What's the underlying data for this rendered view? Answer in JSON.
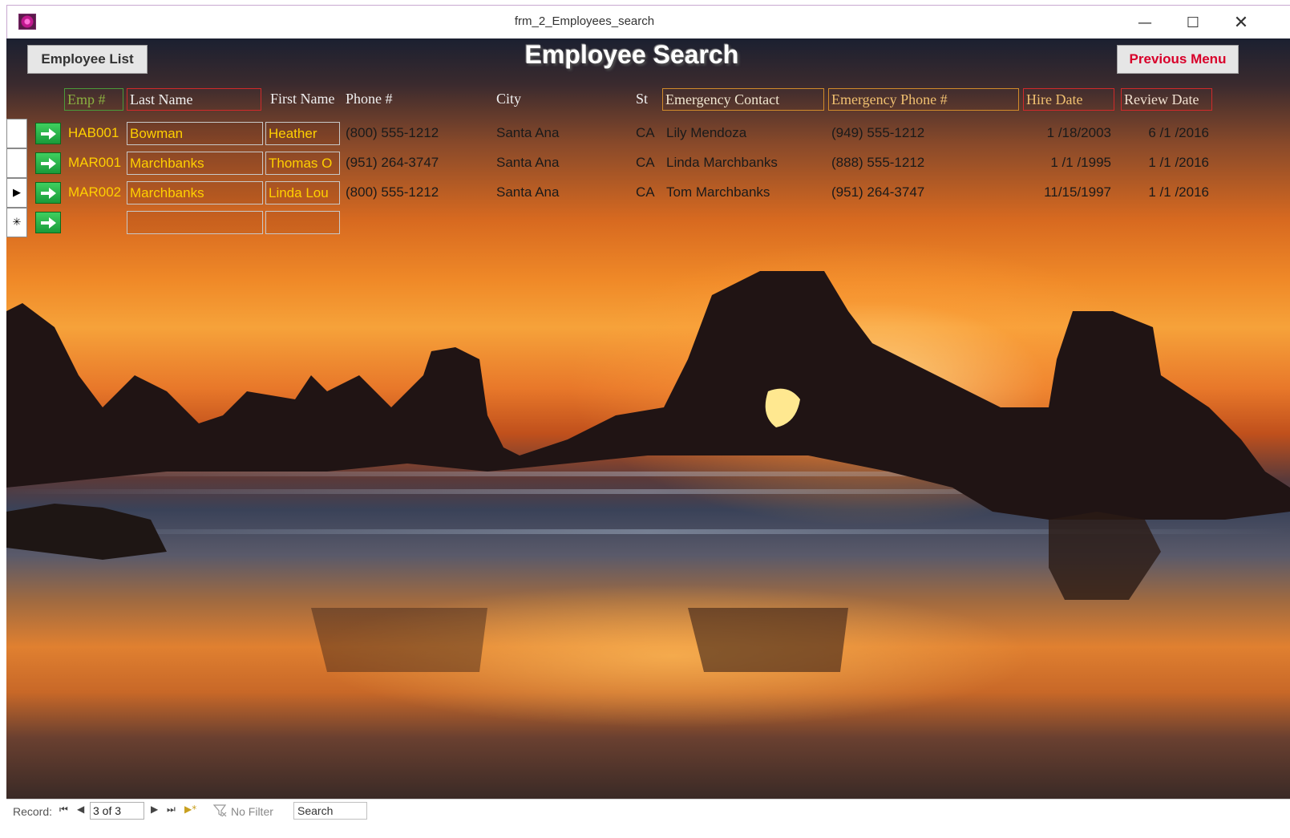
{
  "window": {
    "title": "frm_2_Employees_search",
    "minimize_icon": "minimize-icon",
    "maximize_icon": "maximize-icon",
    "close_icon": "close-icon"
  },
  "header": {
    "employee_list_label": "Employee List",
    "form_title": "Employee Search",
    "previous_menu_label": "Previous Menu"
  },
  "columns": {
    "emp": "Emp #",
    "last": "Last Name",
    "first": "First Name",
    "phone": "Phone #",
    "city": "City",
    "st": "St",
    "emergency_contact": "Emergency Contact",
    "emergency_phone": "Emergency Phone #",
    "hire_date": "Hire Date",
    "review_date": "Review Date"
  },
  "rows": [
    {
      "selector": "",
      "emp": "HAB001",
      "last": "Bowman",
      "first": "Heather",
      "phone": "(800) 555-1212",
      "city": "Santa Ana",
      "st": "CA",
      "emergency_contact": "Lily Mendoza",
      "emergency_phone": "(949) 555-1212",
      "hire_date": "1 /18/2003",
      "review_date": "6 /1 /2016"
    },
    {
      "selector": "",
      "emp": "MAR001",
      "last": "Marchbanks",
      "first": "Thomas O",
      "phone": "(951) 264-3747",
      "city": "Santa Ana",
      "st": "CA",
      "emergency_contact": "Linda Marchbanks",
      "emergency_phone": "(888) 555-1212",
      "hire_date": "1 /1 /1995",
      "review_date": "1 /1 /2016"
    },
    {
      "selector": "▶",
      "emp": "MAR002",
      "last": "Marchbanks",
      "first": "Linda Lou",
      "phone": "(800) 555-1212",
      "city": "Santa Ana",
      "st": "CA",
      "emergency_contact": "Tom Marchbanks",
      "emergency_phone": "(951) 264-3747",
      "hire_date": "11/15/1997",
      "review_date": "1 /1 /2016"
    },
    {
      "selector": "✳",
      "emp": "",
      "last": "",
      "first": "",
      "phone": "",
      "city": "",
      "st": "",
      "emergency_contact": "",
      "emergency_phone": "",
      "hire_date": "",
      "review_date": ""
    }
  ],
  "navigation": {
    "record_label": "Record:",
    "first": "⏮",
    "prev": "◀",
    "current": "3 of 3",
    "next": "▶",
    "last": "⏭",
    "new": "▶*",
    "filter_label": "No Filter",
    "search_label": "Search"
  },
  "colors": {
    "key_field": "#ffd000",
    "previous_menu": "#d8002a",
    "go_button": "#2ab84a"
  }
}
